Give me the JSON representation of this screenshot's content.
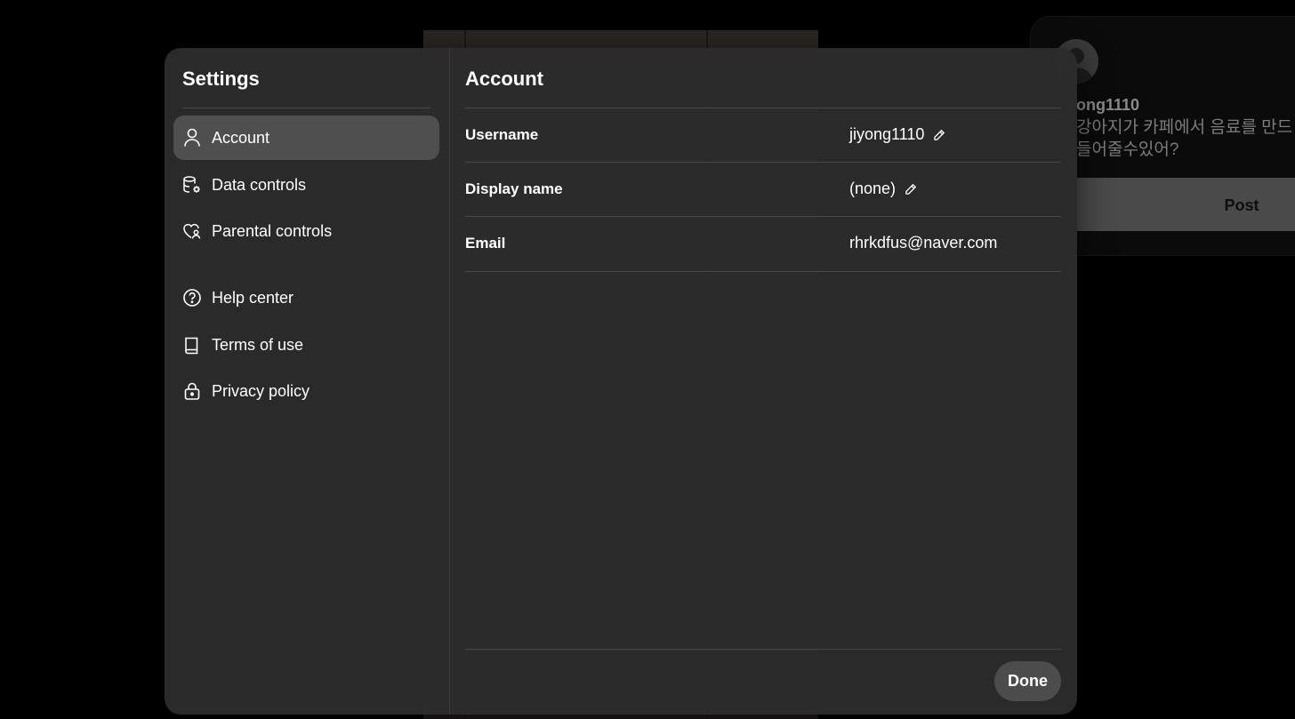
{
  "background": {
    "username": "ong1110",
    "post_text": "강아지가 카페에서 음료를 만드\n들어줄수있어?",
    "post_button": "Post"
  },
  "settings": {
    "title": "Settings",
    "nav_items": [
      {
        "label": "Account",
        "icon": "person-icon",
        "active": true
      },
      {
        "label": "Data controls",
        "icon": "database-gear-icon",
        "active": false
      },
      {
        "label": "Parental controls",
        "icon": "heart-person-icon",
        "active": false
      },
      {
        "label": "Help center",
        "icon": "question-circle-icon",
        "active": false
      },
      {
        "label": "Terms of use",
        "icon": "book-icon",
        "active": false
      },
      {
        "label": "Privacy policy",
        "icon": "lock-icon",
        "active": false
      }
    ]
  },
  "account": {
    "title": "Account",
    "fields": [
      {
        "label": "Username",
        "value": "jiyong1110",
        "editable": true
      },
      {
        "label": "Display name",
        "value": "(none)",
        "editable": true
      },
      {
        "label": "Email",
        "value": "rhrkdfus@naver.com",
        "editable": false
      }
    ],
    "done_label": "Done"
  },
  "colors": {
    "modal_bg": "#2c2c2c",
    "active_nav": "#4f4f4f",
    "done_button": "#4c4c4c"
  }
}
